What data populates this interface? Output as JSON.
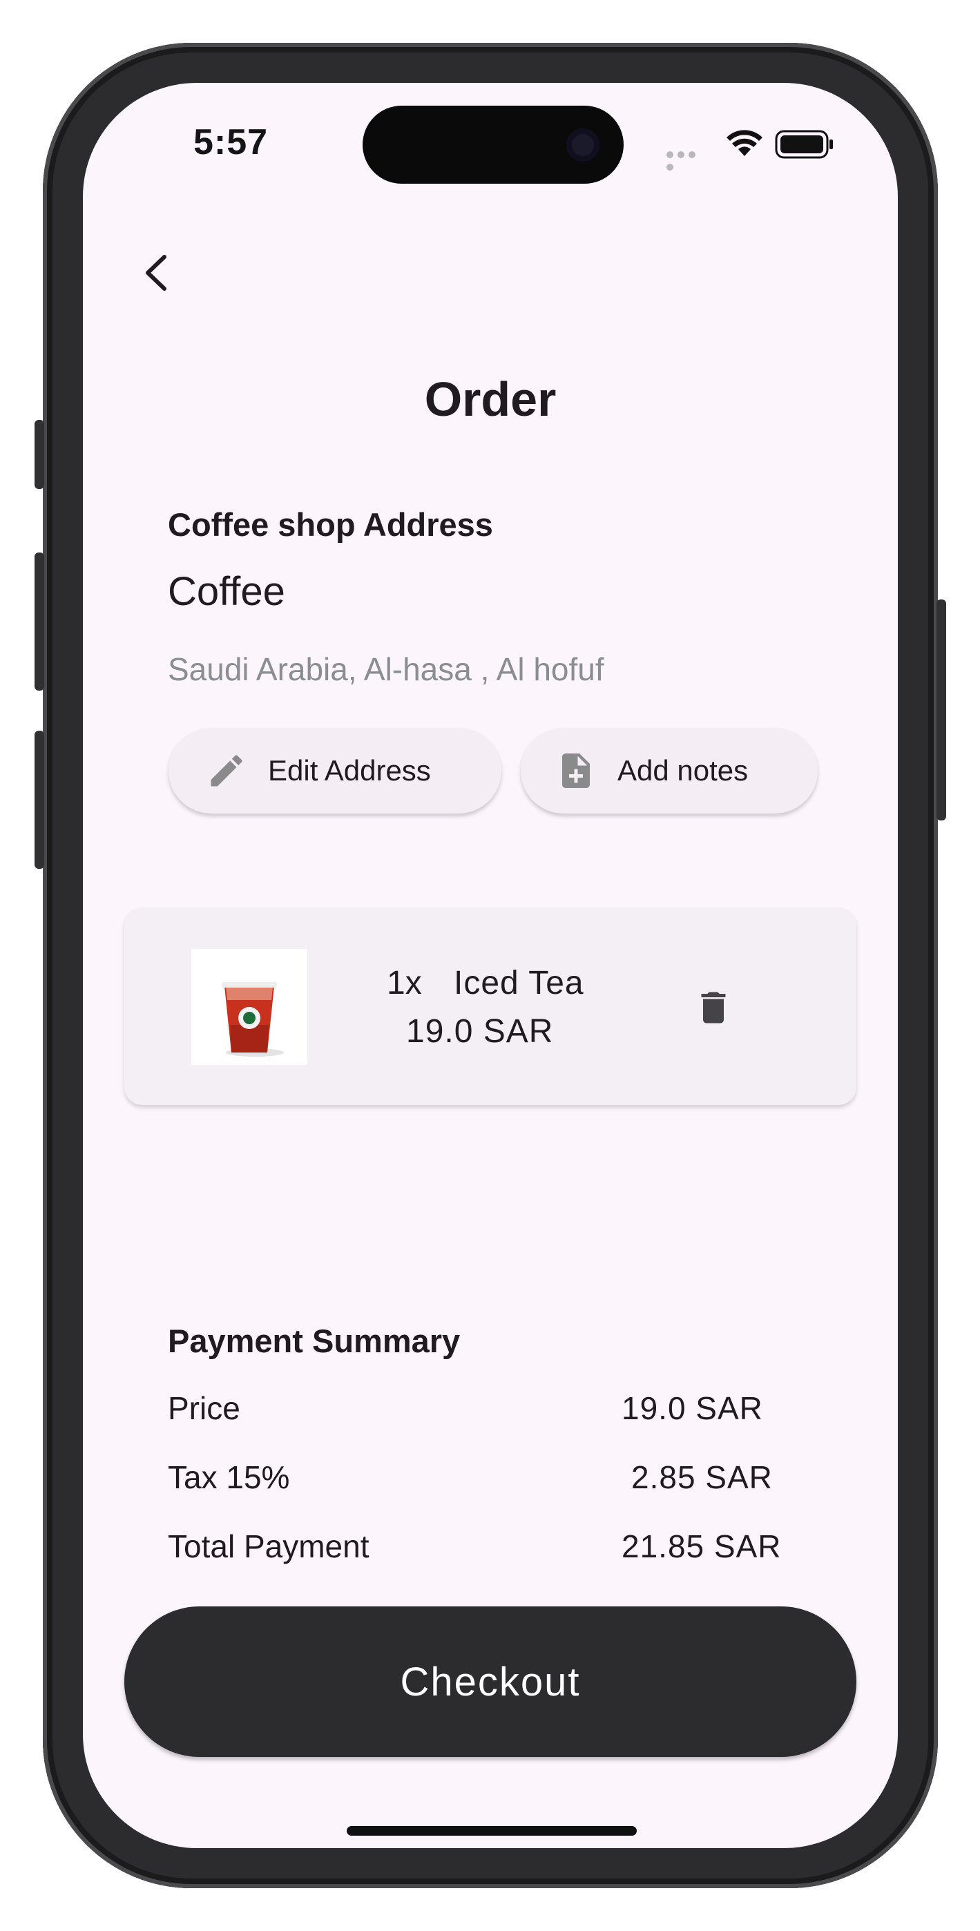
{
  "status_bar": {
    "time": "5:57"
  },
  "header": {
    "title": "Order"
  },
  "shop": {
    "section_label": "Coffee shop Address",
    "name": "Coffee",
    "address": "Saudi Arabia, Al-hasa , Al hofuf"
  },
  "actions": {
    "edit_address_label": "Edit Address",
    "add_notes_label": "Add notes"
  },
  "cart_item": {
    "quantity": "1x",
    "name": "Iced Tea",
    "price": "19.0 SAR"
  },
  "payment_summary": {
    "title": "Payment Summary",
    "rows": [
      {
        "label": "Price",
        "value": "19.0 SAR"
      },
      {
        "label": "Tax 15%",
        "value": "2.85 SAR"
      },
      {
        "label": "Total Payment",
        "value": "21.85 SAR"
      }
    ]
  },
  "checkout_label": "Checkout",
  "colors": {
    "screen_bg": "#fcf5fc",
    "primary_dark": "#2c2b2e",
    "chip_bg": "#f4eef4",
    "muted_text": "#8a8d94"
  },
  "icons": [
    "back-arrow-icon",
    "pencil-icon",
    "note-add-icon",
    "trash-icon",
    "wifi-icon",
    "battery-icon"
  ]
}
